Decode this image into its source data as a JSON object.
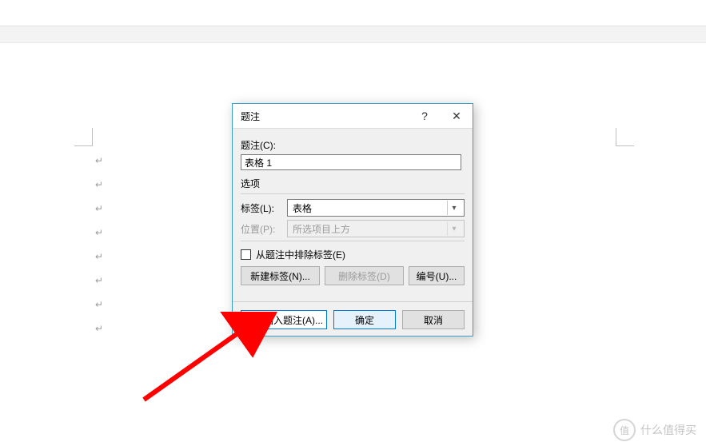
{
  "dialog": {
    "title": "题注",
    "caption_label": "题注(C):",
    "caption_value": "表格 1",
    "options_header": "选项",
    "label_row": {
      "label": "标签(L):",
      "value": "表格"
    },
    "position_row": {
      "label": "位置(P):",
      "value": "所选项目上方"
    },
    "exclude_checkbox": "从题注中排除标签(E)",
    "new_label_btn": "新建标签(N)...",
    "delete_label_btn": "删除标签(D)",
    "numbering_btn": "编号(U)...",
    "auto_caption_btn": "自动插入题注(A)...",
    "ok_btn": "确定",
    "cancel_btn": "取消",
    "help_symbol": "?",
    "close_symbol": "✕"
  },
  "watermark": {
    "icon": "值",
    "text": "什么值得买"
  },
  "para_mark": "↵"
}
